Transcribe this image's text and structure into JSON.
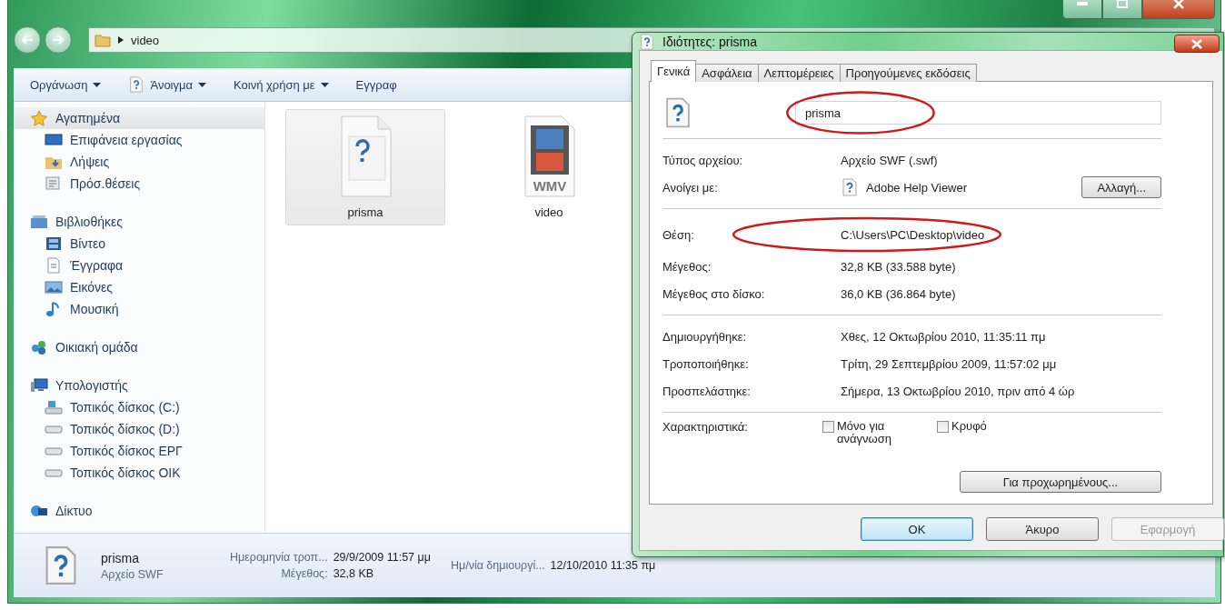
{
  "explorer": {
    "address": {
      "path": "video"
    },
    "toolbar": [
      {
        "label": "Οργάνωση",
        "kind": "plain",
        "dropdown": true
      },
      {
        "label": "Άνοιγμα",
        "kind": "open",
        "dropdown": true
      },
      {
        "label": "Κοινή χρήση με",
        "kind": "plain",
        "dropdown": true
      },
      {
        "label": "Εγγραφ",
        "kind": "plain",
        "dropdown": false
      }
    ],
    "sidebar": [
      {
        "label": "Αγαπημένα",
        "kind": "star",
        "selected": true,
        "children": [
          {
            "label": "Επιφάνεια εργασίας",
            "kind": "desktop",
            "selected": false
          },
          {
            "label": "Λήψεις",
            "kind": "downloads",
            "selected": false
          },
          {
            "label": "Πρόσ.θέσεις",
            "kind": "places",
            "selected": false
          }
        ]
      },
      {
        "label": "Βιβλιοθήκες",
        "kind": "library",
        "selected": false,
        "children": [
          {
            "label": "Βίντεο",
            "kind": "video",
            "selected": false
          },
          {
            "label": "Έγγραφα",
            "kind": "document",
            "selected": false
          },
          {
            "label": "Εικόνες",
            "kind": "pictures",
            "selected": false
          },
          {
            "label": "Μουσική",
            "kind": "music",
            "selected": false
          }
        ]
      },
      {
        "label": "Οικιακή ομάδα",
        "kind": "homegroup",
        "selected": false
      },
      {
        "label": "Υπολογιστής",
        "kind": "computer",
        "selected": false,
        "children": [
          {
            "label": "Τοπικός δίσκος (C:)",
            "kind": "system-drive",
            "selected": false
          },
          {
            "label": "Τοπικός δίσκος (D:)",
            "kind": "drive",
            "selected": false
          },
          {
            "label": "Τοπικός  δίσκος ΕΡΓ",
            "kind": "drive",
            "selected": false
          },
          {
            "label": "Τοπικός δίσκος ΟΙΚ",
            "kind": "drive",
            "selected": false
          }
        ]
      },
      {
        "label": "Δίκτυο",
        "kind": "network",
        "selected": false
      }
    ],
    "files": [
      {
        "name": "prisma",
        "kind": "unknown",
        "selected": true
      },
      {
        "name": "video",
        "kind": "video",
        "badge": "WMV",
        "selected": false
      }
    ],
    "details": {
      "name": "prisma",
      "type": "Αρχείο SWF",
      "fields": [
        {
          "label": "Ημερομηνία τροπ...",
          "value": "29/9/2009 11:57 μμ"
        },
        {
          "label": "Μέγεθος:",
          "value": "32,8 KB"
        },
        {
          "label": "Ημ/νία δημιουργί...",
          "value": "12/10/2010 11:35 πμ"
        }
      ]
    }
  },
  "dialog": {
    "title": "Ιδιότητες: prisma",
    "tabs": [
      {
        "label": "Γενικά",
        "selected": true
      },
      {
        "label": "Ασφάλεια",
        "selected": false
      },
      {
        "label": "Λεπτομέρειες",
        "selected": false
      },
      {
        "label": "Προηγούμενες εκδόσεις",
        "selected": false
      }
    ],
    "file_name": {
      "value": "prisma",
      "highlighted": true
    },
    "sections": [
      {
        "rows": [
          {
            "label": "Τύπος αρχείου:",
            "value": "Αρχείο SWF (.swf)"
          },
          {
            "kind": "app",
            "label": "Ανοίγει με:",
            "value": "Adobe Help Viewer",
            "button": "Αλλαγή..."
          }
        ]
      },
      {
        "rows": [
          {
            "label": "Θέση:",
            "value": "C:\\Users\\PC\\Desktop\\video",
            "highlighted": true
          },
          {
            "label": "Μέγεθος:",
            "value": "32,8 KB (33.588 byte)"
          },
          {
            "label": "Μέγεθος στο δίσκο:",
            "value": "36,0 KB (36.864 byte)"
          }
        ]
      },
      {
        "rows": [
          {
            "label": "Δημιουργήθηκε:",
            "value": "Χθες, 12 Οκτωβρίου 2010, 11:35:11 πμ"
          },
          {
            "label": "Τροποποιήθηκε:",
            "value": "Τρίτη, 29 Σεπτεμβρίου 2009, 11:57:02 μμ"
          },
          {
            "label": "Προσπελάστηκε:",
            "value": "Σήμερα, 13 Οκτωβρίου 2010, πριν από 4 ώρ"
          }
        ]
      }
    ],
    "attributes": {
      "label": "Χαρακτηριστικά:",
      "options": [
        {
          "label": "Μόνο για ανάγνωση",
          "checked": false
        },
        {
          "label": "Κρυφό",
          "checked": false
        }
      ]
    },
    "advanced_button": "Για προχωρημένους...",
    "buttons": [
      {
        "label": "OK",
        "kind": "default"
      },
      {
        "label": "Άκυρο",
        "kind": "normal"
      },
      {
        "label": "Εφαρμογή",
        "kind": "disabled"
      }
    ]
  }
}
